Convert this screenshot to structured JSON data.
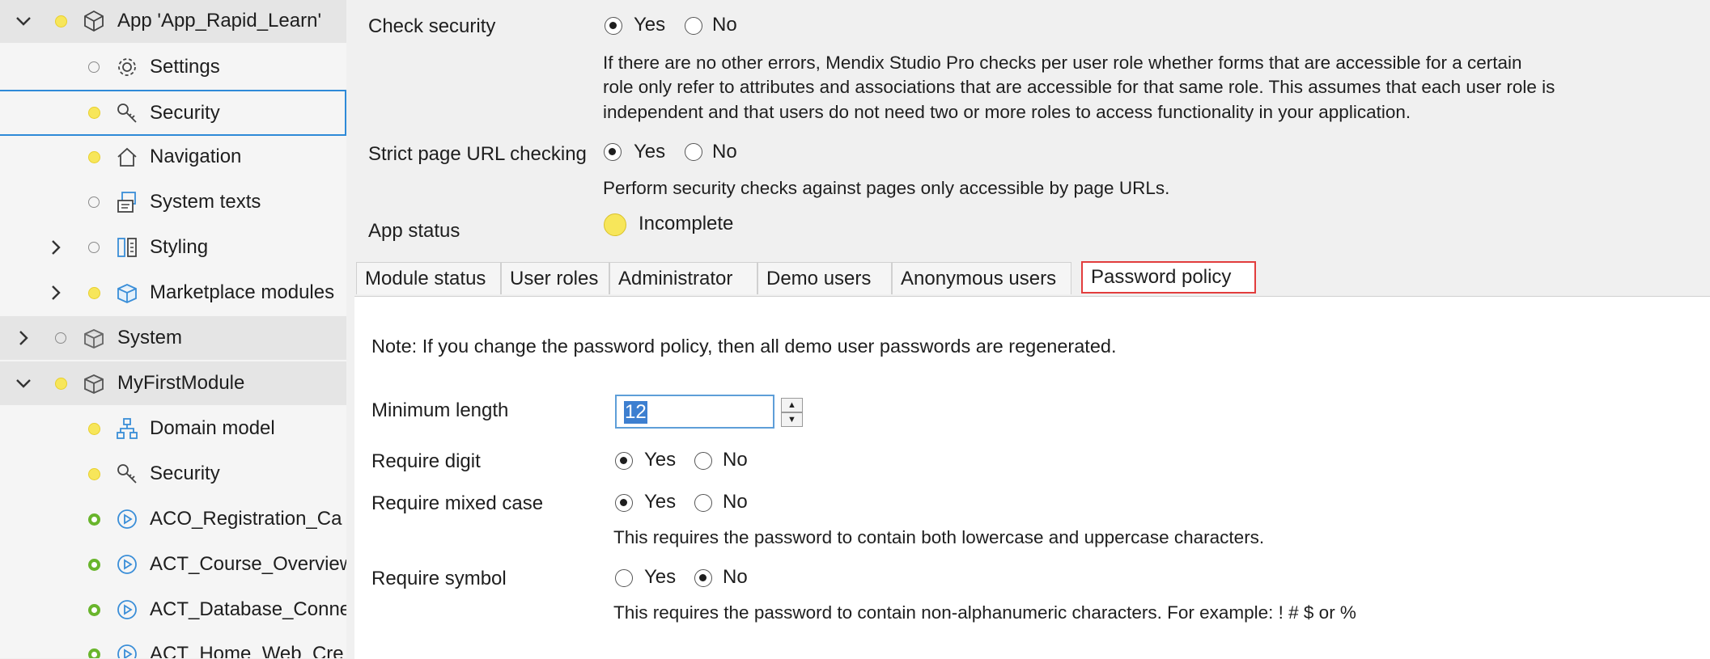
{
  "tree": {
    "items": [
      {
        "label": "App 'App_Rapid_Learn'",
        "icon": "cube-icon",
        "status": "yellow",
        "expander": "expanded"
      },
      {
        "label": "Settings",
        "icon": "gear-icon",
        "status": "empty",
        "expander": ""
      },
      {
        "label": "Security",
        "icon": "key-icon",
        "status": "yellow",
        "expander": ""
      },
      {
        "label": "Navigation",
        "icon": "home-icon",
        "status": "yellow",
        "expander": ""
      },
      {
        "label": "System texts",
        "icon": "text-icon",
        "status": "empty",
        "expander": ""
      },
      {
        "label": "Styling",
        "icon": "styling-icon",
        "status": "empty",
        "expander": "collapsed"
      },
      {
        "label": "Marketplace modules",
        "icon": "marketplace-box-icon",
        "status": "yellow",
        "expander": "collapsed"
      },
      {
        "label": "System",
        "icon": "module-box-icon",
        "status": "empty",
        "expander": "collapsed"
      },
      {
        "label": "MyFirstModule",
        "icon": "module-box-icon",
        "status": "yellow",
        "expander": "expanded"
      },
      {
        "label": "Domain model",
        "icon": "domain-model-icon",
        "status": "yellow",
        "expander": ""
      },
      {
        "label": "Security",
        "icon": "key-icon",
        "status": "yellow",
        "expander": ""
      },
      {
        "label": "ACO_Registration_Ca",
        "icon": "play-circle-icon",
        "status": "green",
        "expander": ""
      },
      {
        "label": "ACT_Course_Overview",
        "icon": "play-circle-icon",
        "status": "green",
        "expander": ""
      },
      {
        "label": "ACT_Database_Conne",
        "icon": "play-circle-icon",
        "status": "green",
        "expander": ""
      },
      {
        "label": "ACT_Home_Web_Cre",
        "icon": "play-circle-icon",
        "status": "green",
        "expander": ""
      }
    ]
  },
  "security": {
    "check_security_label": "Check security",
    "check_security_yes": "Yes",
    "check_security_no": "No",
    "check_security_value": "Yes",
    "check_security_desc_1": "If there are no other errors, Mendix Studio Pro checks per user role whether forms that are accessible for a certain",
    "check_security_desc_2": "role only refer to attributes and associations that are accessible for that same role. This assumes that each user role is",
    "check_security_desc_3": "independent and that users do not need two or more roles to access functionality in your application.",
    "strict_url_label": "Strict page URL checking",
    "strict_url_yes": "Yes",
    "strict_url_no": "No",
    "strict_url_value": "Yes",
    "strict_url_desc": "Perform security checks against pages only accessible by page URLs.",
    "app_status_label": "App status",
    "app_status_value": "Incomplete",
    "app_status_color": "#f7e65a"
  },
  "tabs": [
    {
      "label": "Module status"
    },
    {
      "label": "User roles"
    },
    {
      "label": "Administrator"
    },
    {
      "label": "Demo users"
    },
    {
      "label": "Anonymous users"
    },
    {
      "label": "Password policy"
    }
  ],
  "active_tab": "Password policy",
  "password_policy": {
    "note": "Note: If you change the password policy, then all demo user passwords are regenerated.",
    "min_length_label": "Minimum length",
    "min_length_value": "12",
    "require_digit_label": "Require digit",
    "require_digit_value": "Yes",
    "require_mixed_case_label": "Require mixed case",
    "require_mixed_case_value": "Yes",
    "mixed_case_desc": "This requires the password to contain both lowercase and uppercase characters.",
    "require_symbol_label": "Require symbol",
    "require_symbol_value": "No",
    "symbol_desc": "This requires the password to contain non-alphanumeric characters. For example: ! # $ or %",
    "yes": "Yes",
    "no": "No"
  },
  "colors": {
    "status_yellow": "#f7e65a",
    "status_green": "#69b52c",
    "selection_border": "#2e8ad8",
    "active_tab_border": "#e23d3d",
    "icon_blue": "#3a8ed8"
  }
}
